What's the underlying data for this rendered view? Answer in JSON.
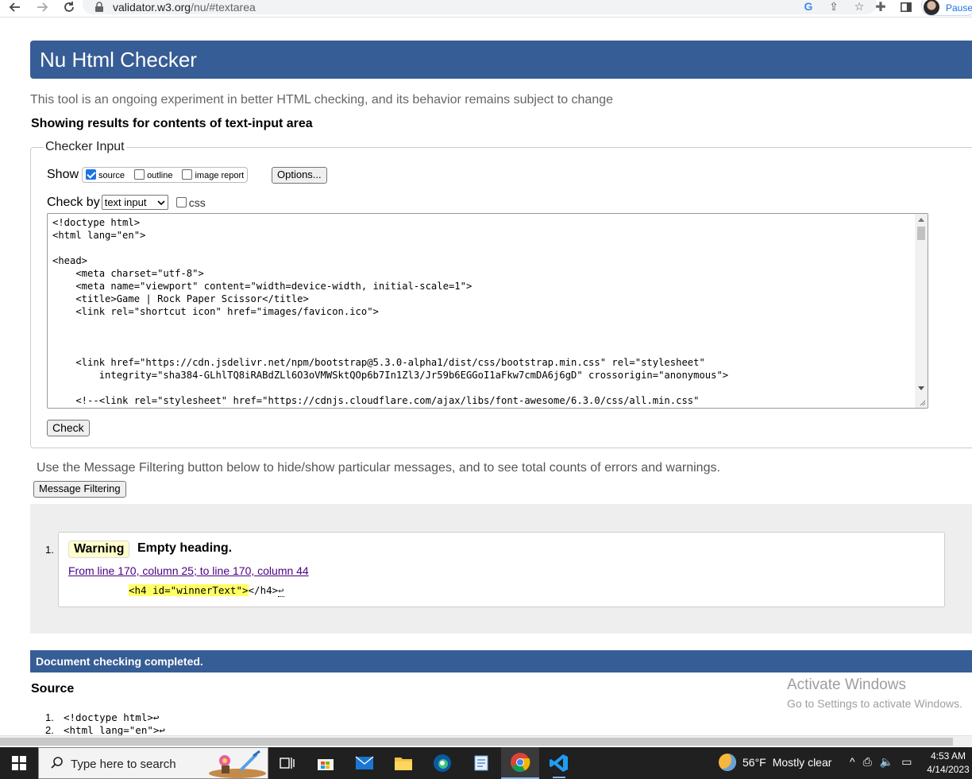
{
  "browser": {
    "url_host": "validator.w3.org",
    "url_path": "/nu/#textarea",
    "profile_status": "Paused"
  },
  "page": {
    "header_title": "Nu Html Checker",
    "tagline": "This tool is an ongoing experiment in better HTML checking, and its behavior remains subject to change",
    "results_title": "Showing results for contents of text-input area"
  },
  "checker": {
    "legend": "Checker Input",
    "show_label": "Show",
    "show_options": [
      {
        "label": "source",
        "checked": true
      },
      {
        "label": "outline",
        "checked": false
      },
      {
        "label": "image report",
        "checked": false
      }
    ],
    "options_button": "Options...",
    "check_by_label": "Check by",
    "check_by_value": "text input",
    "css_label": "css",
    "source_text": "<!doctype html>\n<html lang=\"en\">\n\n<head>\n    <meta charset=\"utf-8\">\n    <meta name=\"viewport\" content=\"width=device-width, initial-scale=1\">\n    <title>Game | Rock Paper Scissor</title>\n    <link rel=\"shortcut icon\" href=\"images/favicon.ico\">\n\n\n\n    <link href=\"https://cdn.jsdelivr.net/npm/bootstrap@5.3.0-alpha1/dist/css/bootstrap.min.css\" rel=\"stylesheet\"\n        integrity=\"sha384-GLhlTQ8iRABdZLl6O3oVMWSktQOp6b7In1Zl3/Jr59b6EGGoI1aFkw7cmDA6j6gD\" crossorigin=\"anonymous\">\n\n    <!--<link rel=\"stylesheet\" href=\"https://cdnjs.cloudflare.com/ajax/libs/font-awesome/6.3.0/css/all.min.css\"",
    "check_button": "Check"
  },
  "filtering": {
    "note": "Use the Message Filtering button below to hide/show particular messages, and to see total counts of errors and warnings.",
    "button": "Message Filtering"
  },
  "messages": [
    {
      "number": "1.",
      "type": "Warning",
      "text": "Empty heading.",
      "location": "From line 170, column 25; to line 170, column 44",
      "extract_highlight": "<h4 id=\"winnerText\">",
      "extract_rest": "</h4>",
      "extract_eol": "↩"
    }
  ],
  "status": {
    "completed": "Document checking completed.",
    "source_title": "Source"
  },
  "source_lines": [
    {
      "n": "1.",
      "code": "<!doctype html>↩"
    },
    {
      "n": "2.",
      "code": "<html lang=\"en\">↩"
    }
  ],
  "watermark": {
    "line1": "Activate Windows",
    "line2": "Go to Settings to activate Windows."
  },
  "taskbar": {
    "search_placeholder": "Type here to search",
    "weather_temp": "56°F",
    "weather_desc": "Mostly clear",
    "time": "4:53 AM",
    "date": "4/14/2023"
  }
}
